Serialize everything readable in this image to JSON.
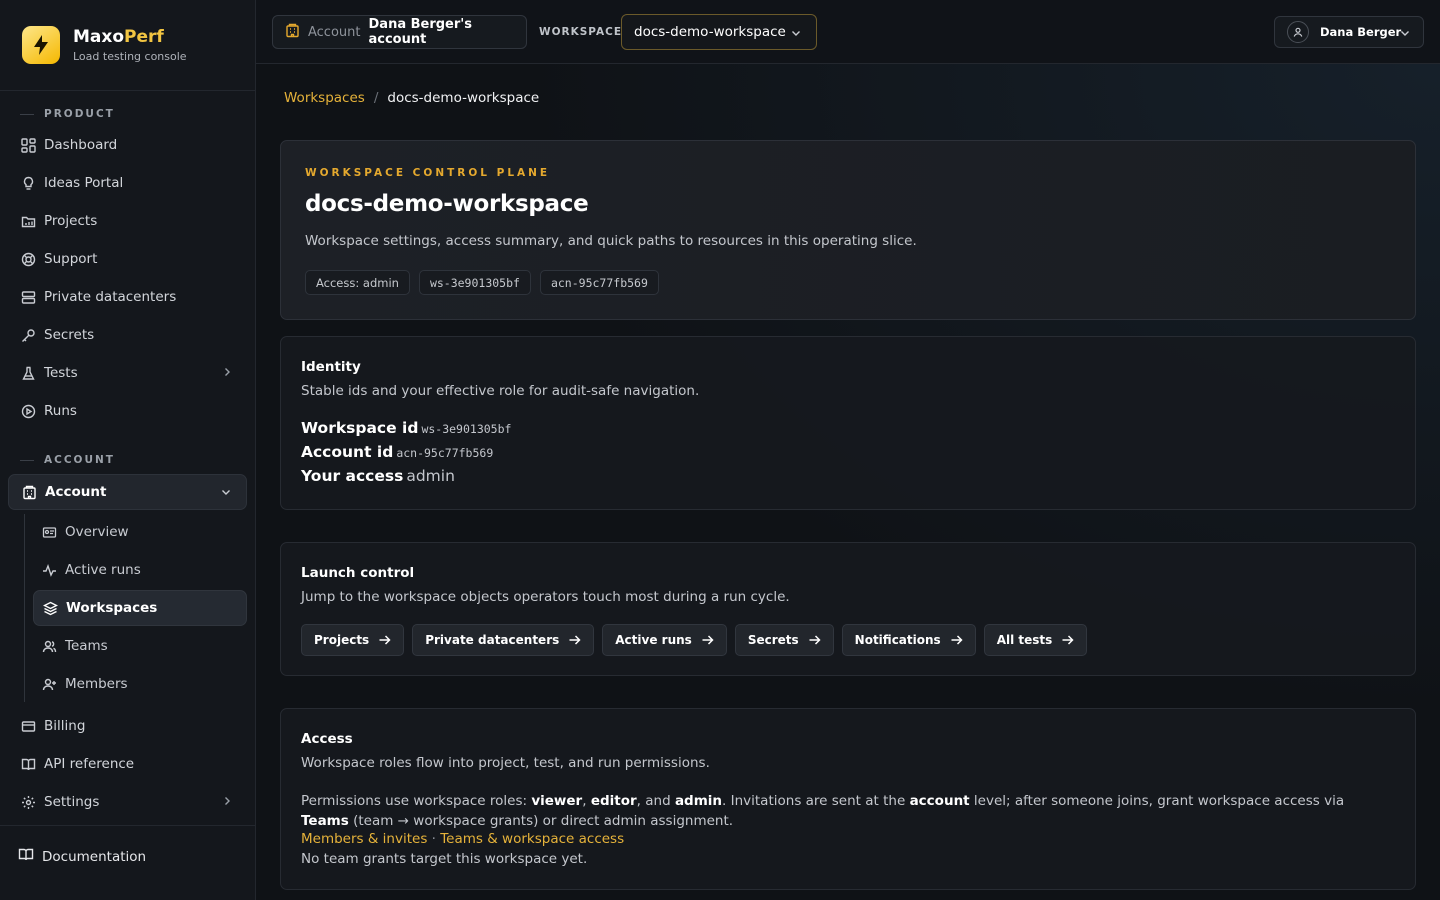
{
  "brand": {
    "name_main": "Maxo",
    "name_accent": "Perf",
    "subtitle": "Load testing console",
    "accent": "#f2c542"
  },
  "sidebar": {
    "product_label": "PRODUCT",
    "account_label": "ACCOUNT",
    "product_items": [
      {
        "label": "Dashboard",
        "icon": "grid-icon"
      },
      {
        "label": "Ideas Portal",
        "icon": "lightbulb-icon"
      },
      {
        "label": "Projects",
        "icon": "folder-icon"
      },
      {
        "label": "Support",
        "icon": "lifebuoy-icon"
      },
      {
        "label": "Private datacenters",
        "icon": "server-icon"
      },
      {
        "label": "Secrets",
        "icon": "key-icon"
      },
      {
        "label": "Tests",
        "icon": "flask-icon"
      },
      {
        "label": "Runs",
        "icon": "play-circle-icon"
      }
    ],
    "account": {
      "label": "Account",
      "icon": "building-icon"
    },
    "account_sub": [
      {
        "label": "Overview",
        "icon": "id-card-icon"
      },
      {
        "label": "Active runs",
        "icon": "activity-icon"
      },
      {
        "label": "Workspaces",
        "icon": "layers-icon"
      },
      {
        "label": "Teams",
        "icon": "users-icon"
      },
      {
        "label": "Members",
        "icon": "user-plus-icon"
      }
    ],
    "bottom_items": [
      {
        "label": "Billing",
        "icon": "credit-card-icon"
      },
      {
        "label": "API reference",
        "icon": "book-icon"
      },
      {
        "label": "Settings",
        "icon": "gear-icon"
      }
    ],
    "footer": {
      "label": "Documentation",
      "icon": "book-open-icon"
    }
  },
  "header": {
    "account_prefix": "Account",
    "account_name": "Dana Berger's account",
    "workspace_label": "WORKSPACE",
    "workspace_value": "docs-demo-workspace",
    "user_name": "Dana Berger"
  },
  "breadcrumb": {
    "parent": "Workspaces",
    "separator": "/",
    "current": "docs-demo-workspace"
  },
  "hero": {
    "eyebrow": "WORKSPACE CONTROL PLANE",
    "title": "docs-demo-workspace",
    "description": "Workspace settings, access summary, and quick paths to resources in this operating slice.",
    "chips": [
      "Access: admin",
      "ws-3e901305bf",
      "acn-95c77fb569"
    ]
  },
  "identity": {
    "title": "Identity",
    "description": "Stable ids and your effective role for audit-safe navigation.",
    "workspace_id_label": "Workspace id",
    "workspace_id": "ws-3e901305bf",
    "account_id_label": "Account id",
    "account_id": "acn-95c77fb569",
    "access_label": "Your access",
    "access_value": "admin"
  },
  "launch": {
    "title": "Launch control",
    "description": "Jump to the workspace objects operators touch most during a run cycle.",
    "buttons": [
      "Projects",
      "Private datacenters",
      "Active runs",
      "Secrets",
      "Notifications",
      "All tests"
    ]
  },
  "access": {
    "title": "Access",
    "description": "Workspace roles flow into project, test, and run permissions.",
    "p_1": "Permissions use workspace roles: ",
    "role_viewer": "viewer",
    "p_2": ", ",
    "role_editor": "editor",
    "p_3": ", and ",
    "role_admin": "admin",
    "p_4": ". Invitations are sent at the ",
    "level_account": "account",
    "p_5": " level; after someone joins, grant workspace access via ",
    "teams": "Teams",
    "p_6": " (team → workspace grants) or direct admin assignment.",
    "link_members": "Members & invites",
    "link_sep": " · ",
    "link_teams": "Teams & workspace access",
    "note": "No team grants target this workspace yet."
  }
}
